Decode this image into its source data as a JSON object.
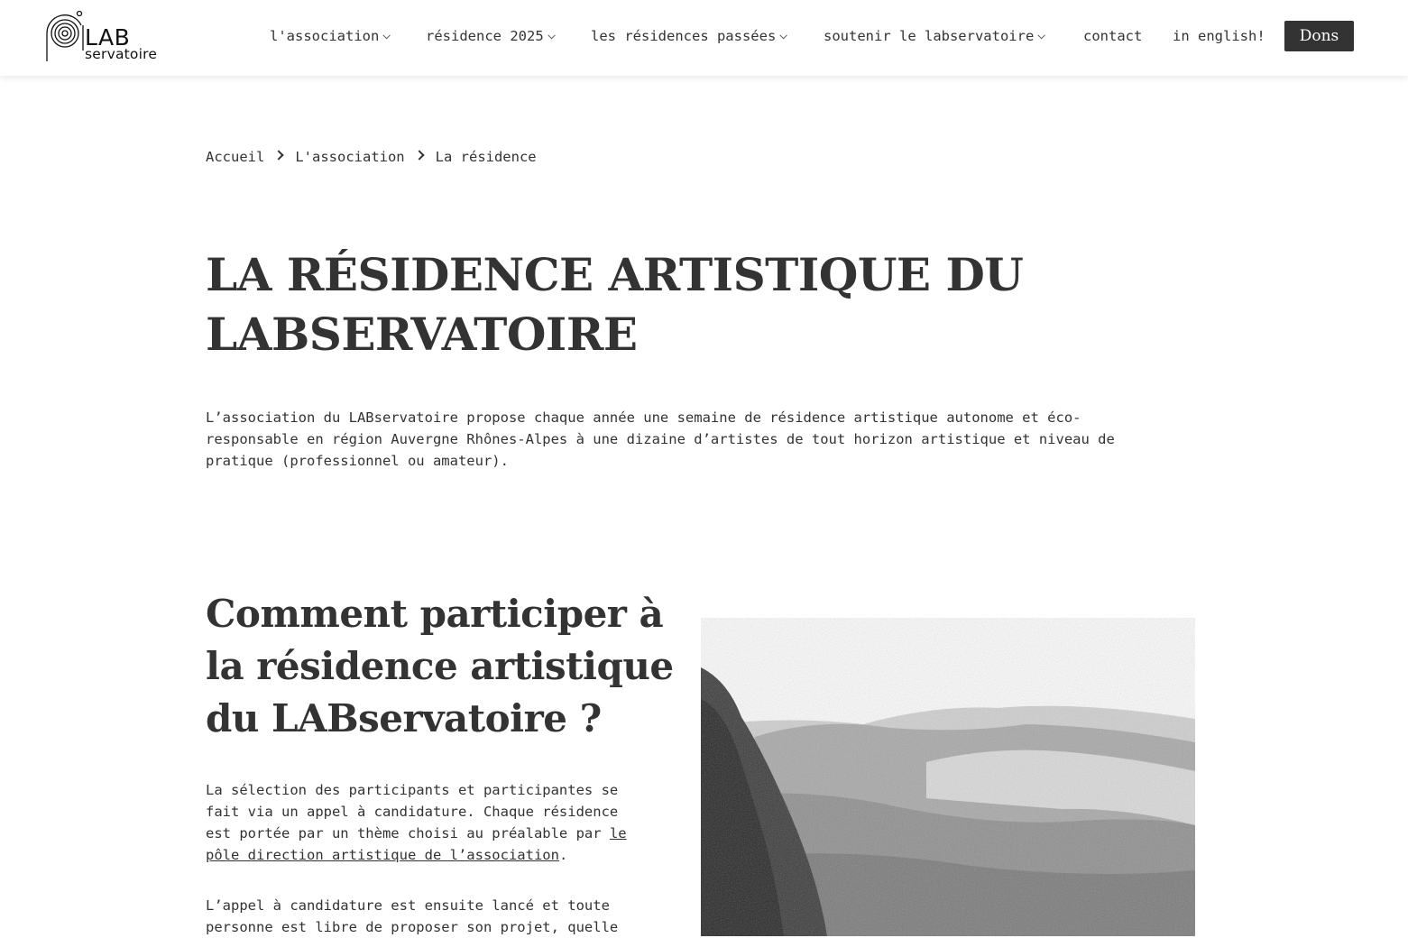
{
  "header": {
    "logo": {
      "line1": "LAB",
      "line2": "servatoire"
    },
    "nav": [
      {
        "label": "l'association",
        "has_dropdown": true
      },
      {
        "label": "résidence 2025",
        "has_dropdown": true
      },
      {
        "label": "les résidences passées",
        "has_dropdown": true
      },
      {
        "label": "soutenir le labservatoire",
        "has_dropdown": true
      },
      {
        "label": "contact",
        "has_dropdown": false
      },
      {
        "label": "in english!",
        "has_dropdown": false
      }
    ],
    "donate_label": "Dons"
  },
  "breadcrumb": [
    "Accueil",
    "L'association",
    "La résidence"
  ],
  "page_title": "LA RÉSIDENCE ARTISTIQUE DU LABSERVATOIRE",
  "intro": "L’association du LABservatoire propose chaque année une semaine de résidence artistique autonome et éco-responsable en région Auvergne Rhônes-Alpes à une dizaine d’artistes de tout horizon artistique et niveau de pratique (professionnel ou amateur).",
  "section": {
    "heading": "Comment participer à la résidence artistique du LABservatoire ?",
    "para1_before_link": "La sélection des participants et participantes se fait via un appel à candidature. Chaque résidence est portée par un thème choisi au préalable par ",
    "para1_link": "le pôle direction artistique de l’association",
    "para1_after_link": ".",
    "para2": "L’appel à candidature est ensuite lancé et toute personne est libre de proposer son projet, quelle"
  },
  "colors": {
    "text": "#333333",
    "button_bg": "#333333",
    "button_text": "#ffffff",
    "background": "#ffffff"
  }
}
